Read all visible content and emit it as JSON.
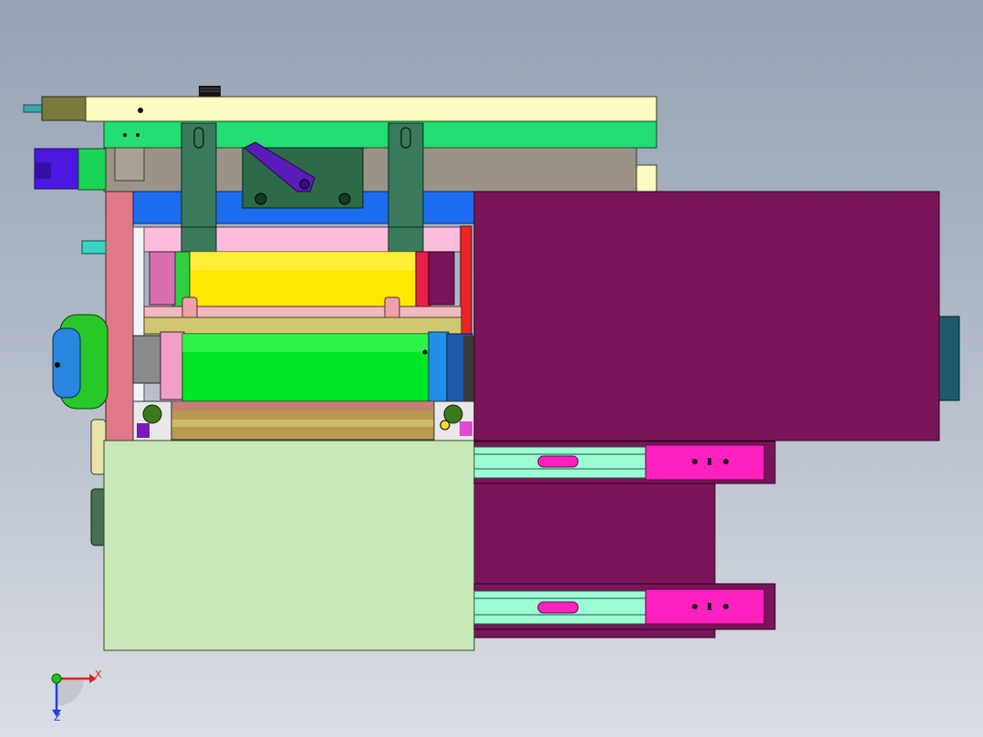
{
  "triad": {
    "x_label": "X",
    "z_label": "Z",
    "x_color": "#e02020",
    "y_color": "#18c818",
    "z_color": "#2040e0"
  },
  "colors": {
    "top_bar": "#fafcc0",
    "green_plate": "#22dd72",
    "grey_plate": "#9a9488",
    "blue_bar": "#1c6cf0",
    "pink_bar": "#fcbcdc",
    "yellow_roller": "#ffe800",
    "green_roller": "#00e626",
    "rod": "#e8a0a8",
    "olive_roller": "#b8b060",
    "purple_panel": "#7a1458",
    "pale_green_box": "#c8e8b8",
    "slide_rail": "#9cfcd4",
    "slide_end": "#ff20c0",
    "side_frame": "#e07888",
    "motor_violet": "#4a18e0",
    "teal_knob": "#1e5a6a"
  }
}
